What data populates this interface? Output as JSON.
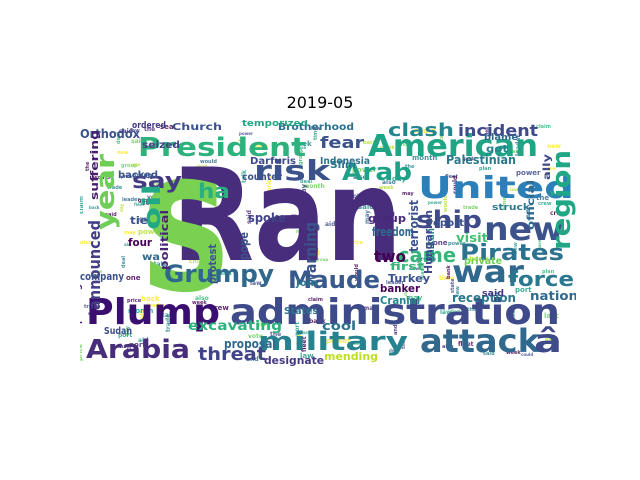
{
  "title": "2019-05",
  "words": [
    {
      "text": "Ran",
      "color": "#472d7b"
    },
    {
      "text": "S",
      "color": "#7ad151"
    },
    {
      "text": "Plump",
      "color": "#3b0f70"
    },
    {
      "text": "administration",
      "color": "#3e4a89"
    },
    {
      "text": "American",
      "color": "#20a486"
    },
    {
      "text": "United",
      "color": "#2c7fb8"
    },
    {
      "text": "President",
      "color": "#2db27d"
    },
    {
      "text": "attack",
      "color": "#31688e"
    },
    {
      "text": "â",
      "color": "#3e4a89"
    },
    {
      "text": "Arabia",
      "color": "#472d7b"
    },
    {
      "text": "military",
      "color": "#26828e"
    },
    {
      "text": "new",
      "color": "#3b528b"
    },
    {
      "text": "war",
      "color": "#31688e"
    },
    {
      "text": "risk",
      "color": "#3b528b"
    },
    {
      "text": "Arab",
      "color": "#1fa187"
    },
    {
      "text": "Maude",
      "color": "#38598c"
    },
    {
      "text": "Grumpy",
      "color": "#30688d"
    },
    {
      "text": "region",
      "color": "#22a785"
    },
    {
      "text": "ship",
      "color": "#3e4a89"
    },
    {
      "text": "Pirates",
      "color": "#2c728e"
    },
    {
      "text": "year",
      "color": "#6ece58"
    },
    {
      "text": "say",
      "color": "#443a83"
    },
    {
      "text": "force",
      "color": "#2a788e"
    },
    {
      "text": "came",
      "color": "#35b779"
    },
    {
      "text": "threat",
      "color": "#414487"
    },
    {
      "text": "clash",
      "color": "#25858e"
    },
    {
      "text": "incident",
      "color": "#3e4a89"
    },
    {
      "text": "fear",
      "color": "#3b528b"
    },
    {
      "text": "oil",
      "color": "#22a884"
    },
    {
      "text": "ha",
      "color": "#2ab07f"
    },
    {
      "text": "two",
      "color": "#440154"
    },
    {
      "text": "warning",
      "color": "#3b528b"
    },
    {
      "text": "announced",
      "color": "#433e85"
    },
    {
      "text": "excavating",
      "color": "#2db27d"
    },
    {
      "text": "reception",
      "color": "#2a788e"
    },
    {
      "text": "nation",
      "color": "#31688e"
    },
    {
      "text": "mending",
      "color": "#bddf26"
    },
    {
      "text": "designate",
      "color": "#443a83"
    },
    {
      "text": "cool",
      "color": "#2c728e"
    },
    {
      "text": "Church",
      "color": "#3b528b"
    },
    {
      "text": "Brotherhood",
      "color": "#2c728e"
    },
    {
      "text": "Orthodox",
      "color": "#3b528b"
    },
    {
      "text": "Palestinian",
      "color": "#2a788e"
    },
    {
      "text": "ordered",
      "color": "#443a83"
    },
    {
      "text": "temporized",
      "color": "#22a884"
    },
    {
      "text": "Slim",
      "color": "#2a788e"
    },
    {
      "text": "seized",
      "color": "#433e85"
    },
    {
      "text": "backed",
      "color": "#3b528b"
    },
    {
      "text": "suffering",
      "color": "#481f70"
    },
    {
      "text": "political",
      "color": "#482475"
    },
    {
      "text": "spoke",
      "color": "#414487"
    },
    {
      "text": "pope",
      "color": "#3b528b"
    },
    {
      "text": "freedom",
      "color": "#31688e"
    },
    {
      "text": "group",
      "color": "#482878"
    },
    {
      "text": "terrorist",
      "color": "#3b528b"
    },
    {
      "text": "Balkan",
      "color": "#26828e"
    },
    {
      "text": "Hungarian",
      "color": "#3e4a89"
    },
    {
      "text": "proposal",
      "color": "#31688e"
    },
    {
      "text": "States",
      "color": "#2c728e"
    },
    {
      "text": "Turkey",
      "color": "#3b528b"
    },
    {
      "text": "first",
      "color": "#35b779"
    },
    {
      "text": "Cranial",
      "color": "#25858e"
    },
    {
      "text": "banker",
      "color": "#440154"
    },
    {
      "text": "counter",
      "color": "#3b528b"
    },
    {
      "text": "Darfuris",
      "color": "#3e4a89"
    },
    {
      "text": "Indonesia",
      "color": "#2c728e"
    },
    {
      "text": "visit",
      "color": "#44bf70"
    },
    {
      "text": "report",
      "color": "#3b528b"
    },
    {
      "text": "said",
      "color": "#443a83"
    },
    {
      "text": "private",
      "color": "#6ece58"
    },
    {
      "text": "official",
      "color": "#31688e"
    },
    {
      "text": "got",
      "color": "#26828e"
    },
    {
      "text": "ally",
      "color": "#3e4a89"
    },
    {
      "text": "struck",
      "color": "#2a788e"
    },
    {
      "text": "blame",
      "color": "#31688e"
    },
    {
      "text": "company",
      "color": "#3b528b"
    },
    {
      "text": "tie",
      "color": "#3b528b"
    },
    {
      "text": "four",
      "color": "#440154"
    },
    {
      "text": "upsetting",
      "color": "#482475"
    },
    {
      "text": "Sudan",
      "color": "#3e4a89"
    },
    {
      "text": "protest",
      "color": "#3b528b"
    },
    {
      "text": "join",
      "color": "#2a788e"
    },
    {
      "text": "wa",
      "color": "#31688e"
    }
  ]
}
